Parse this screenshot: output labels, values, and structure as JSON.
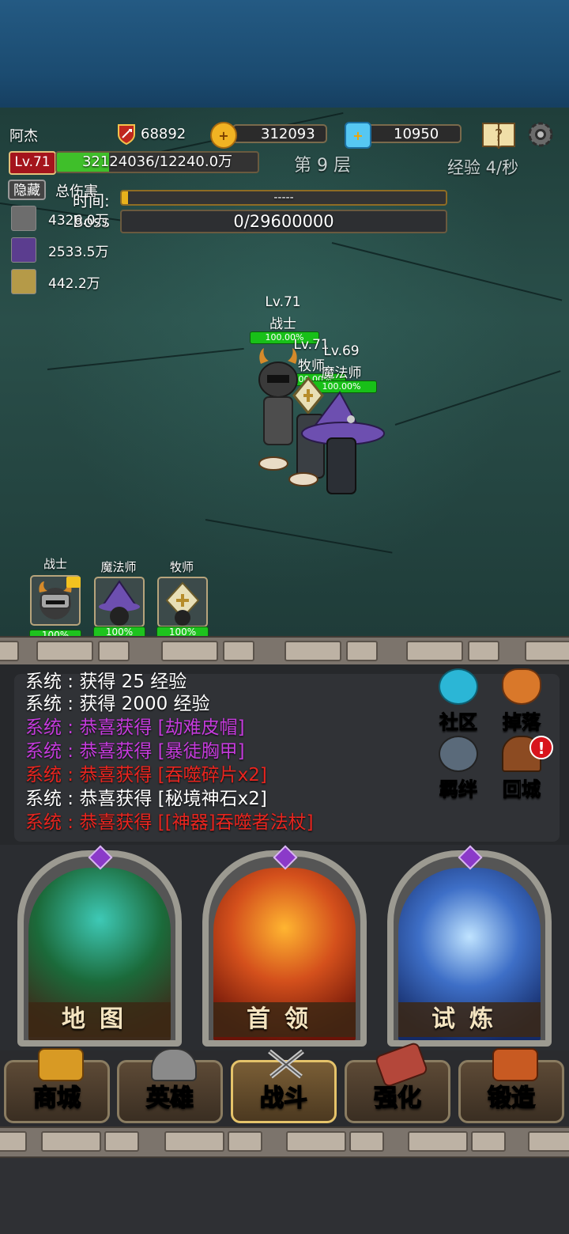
{
  "header": {
    "player_name": "阿杰",
    "attack": "68892",
    "gold": "312093",
    "diamond": "10950",
    "level": "Lv.71",
    "exp_text": "32124036/12240.0万",
    "exp_fraction": 0.26,
    "floor": "第 9 层",
    "exp_rate": "经验 4/秒"
  },
  "damage_panel": {
    "hide_label": "隐藏",
    "total_damage_label": "总伤害",
    "time_label": "时间:",
    "time_value": "-----",
    "boss_label": "Boss",
    "boss_hp": "0/29600000",
    "rows": [
      {
        "hero": "warrior",
        "value": "4326.0万"
      },
      {
        "hero": "mage",
        "value": "2533.5万"
      },
      {
        "hero": "priest",
        "value": "442.2万"
      }
    ]
  },
  "battle_units": [
    {
      "level": "Lv.71",
      "name": "战士",
      "hp": "100.00%"
    },
    {
      "level": "Lv.71",
      "name": "牧师",
      "hp": "100.00%"
    },
    {
      "level": "Lv.69",
      "name": "魔法师",
      "hp": "100.00%"
    }
  ],
  "hero_cards": [
    {
      "name": "战士",
      "hp": "100%"
    },
    {
      "name": "魔法师",
      "hp": "100%"
    },
    {
      "name": "牧师",
      "hp": "100%"
    }
  ],
  "log": [
    {
      "prefix": "系统 :",
      "text": "获得 25 经验",
      "color": "#ffffff"
    },
    {
      "prefix": "系统 :",
      "text": "获得 2000 经验",
      "color": "#ffffff"
    },
    {
      "prefix": "系统 :",
      "text": "恭喜获得 [劫难皮帽]",
      "color": "#c53bdc"
    },
    {
      "prefix": "系统 :",
      "text": "恭喜获得 [暴徒胸甲]",
      "color": "#c53bdc"
    },
    {
      "prefix": "系统 :",
      "text": "恭喜获得 [吞噬碎片x2]",
      "color": "#e8251f"
    },
    {
      "prefix": "系统 :",
      "text": "恭喜获得 [秘境神石x2]",
      "color": "#ffffff"
    },
    {
      "prefix": "系统 :",
      "text": "恭喜获得 [[神器]吞噬者法杖]",
      "color": "#e8251f"
    }
  ],
  "side_buttons": {
    "community": "社区",
    "drops": "掉落",
    "bond": "羁绊",
    "return_city": "回城",
    "alert_mark": "!"
  },
  "portals": {
    "map": "地图",
    "boss": "首领",
    "trial": "试炼"
  },
  "nav": {
    "shop": "商城",
    "heroes": "英雄",
    "battle": "战斗",
    "enhance": "强化",
    "forge": "锻造"
  },
  "colors": {
    "exp_bar": "#3fbf2a",
    "time_bar": "#e8b21c",
    "epic": "#c53bdc",
    "legendary": "#e8251f"
  }
}
